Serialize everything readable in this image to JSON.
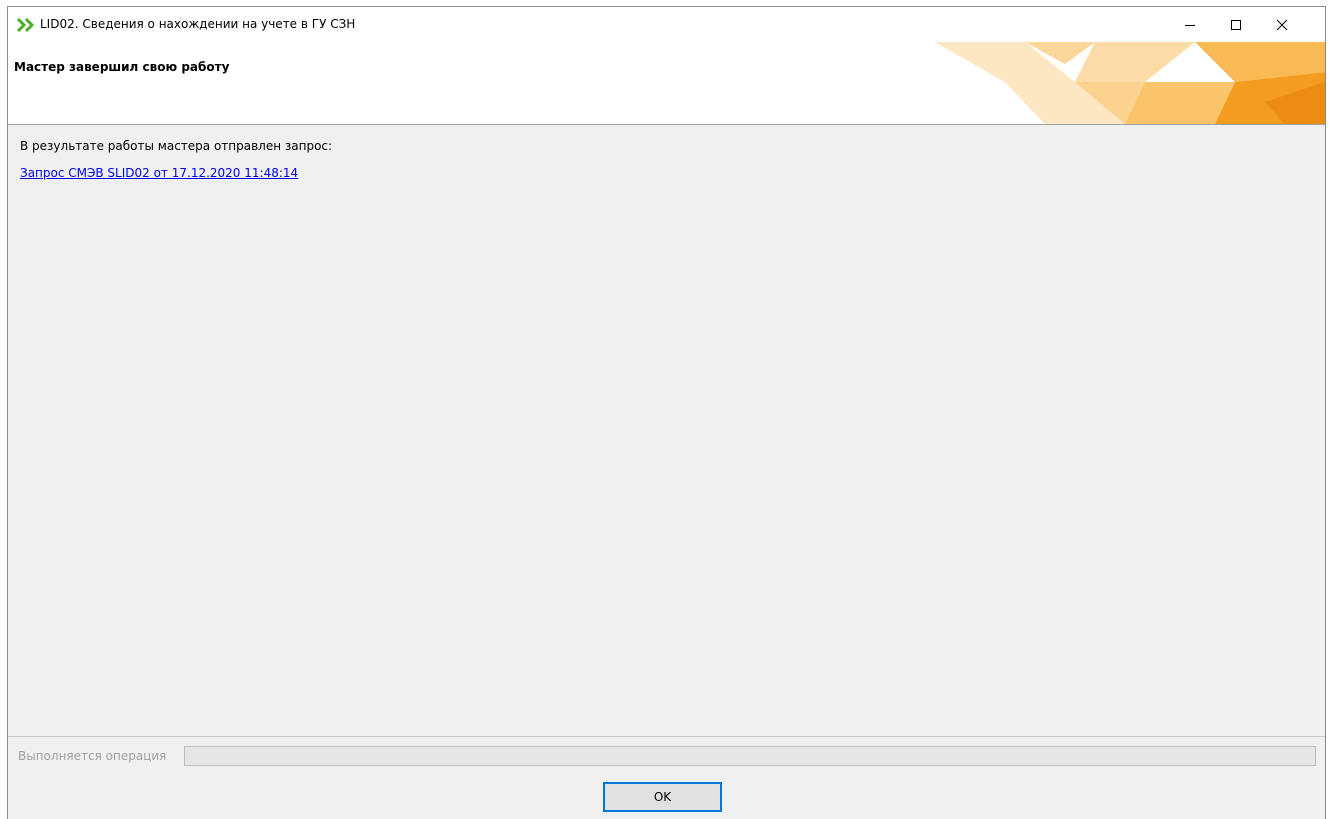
{
  "window": {
    "title": "LID02. Сведения о нахождении на учете в ГУ СЗН",
    "app_icon": "double-chevron-right-icon",
    "controls": [
      "minimize-icon",
      "maximize-icon",
      "close-icon"
    ]
  },
  "header": {
    "title": "Мастер завершил свою работу"
  },
  "content": {
    "result_text": "В результате работы мастера отправлен запрос:",
    "request_link": "Запрос СМЭВ SLID02 от 17.12.2020 11:48:14"
  },
  "footer": {
    "operation_label": "Выполняется операция",
    "progress": 0,
    "ok_label": "OK"
  },
  "colors": {
    "accent": "#0078d7",
    "link": "#0000ee",
    "banner_orange": "#f39c1f",
    "icon_green": "#4caf2a"
  }
}
